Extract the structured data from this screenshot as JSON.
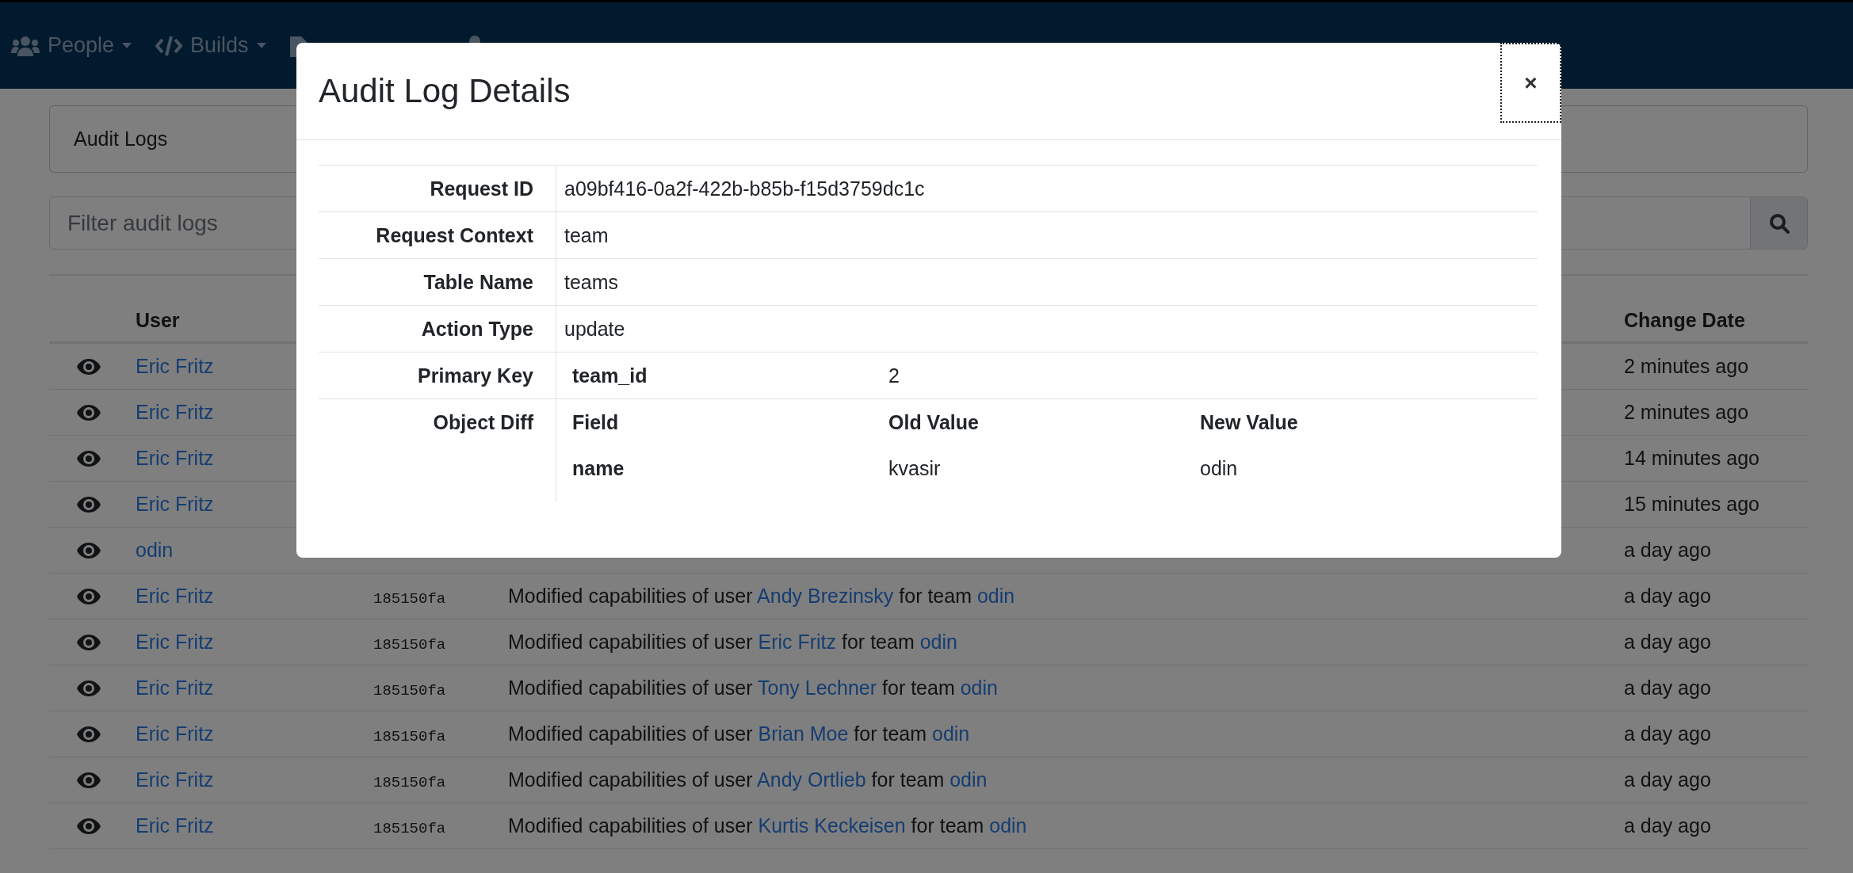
{
  "navbar": {
    "items": [
      {
        "label": "People",
        "dropdown": true
      },
      {
        "label": "Builds",
        "dropdown": true
      },
      {
        "dropdown": false
      },
      {
        "dropdown": false
      }
    ]
  },
  "card": {
    "title": "Audit Logs"
  },
  "filter": {
    "placeholder": "Filter audit logs"
  },
  "table": {
    "columns": {
      "user": "User",
      "change_date": "Change Date"
    },
    "rows": [
      {
        "user": "Eric Fritz",
        "date": "2 minutes ago"
      },
      {
        "user": "Eric Fritz",
        "date": "2 minutes ago"
      },
      {
        "user": "Eric Fritz",
        "date": "14 minutes ago"
      },
      {
        "user": "Eric Fritz",
        "date": "15 minutes ago"
      },
      {
        "user": "odin",
        "date": "a day ago"
      },
      {
        "user": "Eric Fritz",
        "sha": "185150fa",
        "description": [
          {
            "kind": "text",
            "text": "Modified capabilities of user "
          },
          {
            "kind": "link",
            "text": "Andy Brezinsky"
          },
          {
            "kind": "text",
            "text": " for team "
          },
          {
            "kind": "link",
            "text": "odin"
          }
        ],
        "date": "a day ago"
      },
      {
        "user": "Eric Fritz",
        "sha": "185150fa",
        "description": [
          {
            "kind": "text",
            "text": "Modified capabilities of user "
          },
          {
            "kind": "link",
            "text": "Eric Fritz"
          },
          {
            "kind": "text",
            "text": " for team "
          },
          {
            "kind": "link",
            "text": "odin"
          }
        ],
        "date": "a day ago"
      },
      {
        "user": "Eric Fritz",
        "sha": "185150fa",
        "description": [
          {
            "kind": "text",
            "text": "Modified capabilities of user "
          },
          {
            "kind": "link",
            "text": "Tony Lechner"
          },
          {
            "kind": "text",
            "text": " for team "
          },
          {
            "kind": "link",
            "text": "odin"
          }
        ],
        "date": "a day ago"
      },
      {
        "user": "Eric Fritz",
        "sha": "185150fa",
        "description": [
          {
            "kind": "text",
            "text": "Modified capabilities of user "
          },
          {
            "kind": "link",
            "text": "Brian Moe"
          },
          {
            "kind": "text",
            "text": " for team "
          },
          {
            "kind": "link",
            "text": "odin"
          }
        ],
        "date": "a day ago"
      },
      {
        "user": "Eric Fritz",
        "sha": "185150fa",
        "description": [
          {
            "kind": "text",
            "text": "Modified capabilities of user "
          },
          {
            "kind": "link",
            "text": "Andy Ortlieb"
          },
          {
            "kind": "text",
            "text": " for team "
          },
          {
            "kind": "link",
            "text": "odin"
          }
        ],
        "date": "a day ago"
      },
      {
        "user": "Eric Fritz",
        "sha": "185150fa",
        "description": [
          {
            "kind": "text",
            "text": "Modified capabilities of user "
          },
          {
            "kind": "link",
            "text": "Kurtis Keckeisen"
          },
          {
            "kind": "text",
            "text": " for team "
          },
          {
            "kind": "link",
            "text": "odin"
          }
        ],
        "date": "a day ago"
      }
    ]
  },
  "modal": {
    "title": "Audit Log Details",
    "close": {
      "label": "×",
      "focused": true
    },
    "fields": [
      {
        "label": "Request ID",
        "kind": "text",
        "value": "a09bf416-0a2f-422b-b85b-f15d3759dc1c"
      },
      {
        "label": "Request Context",
        "kind": "text",
        "value": "team"
      },
      {
        "label": "Table Name",
        "kind": "text",
        "value": "teams"
      },
      {
        "label": "Action Type",
        "kind": "text",
        "value": "update"
      },
      {
        "label": "Primary Key",
        "kind": "keys",
        "rows": [
          {
            "key": "team_id",
            "value": "2"
          }
        ]
      },
      {
        "label": "Object Diff",
        "kind": "diff",
        "columns": [
          "Field",
          "Old Value",
          "New Value"
        ],
        "rows": [
          {
            "field": "name",
            "old": "kvasir",
            "new": "odin"
          }
        ]
      }
    ]
  }
}
